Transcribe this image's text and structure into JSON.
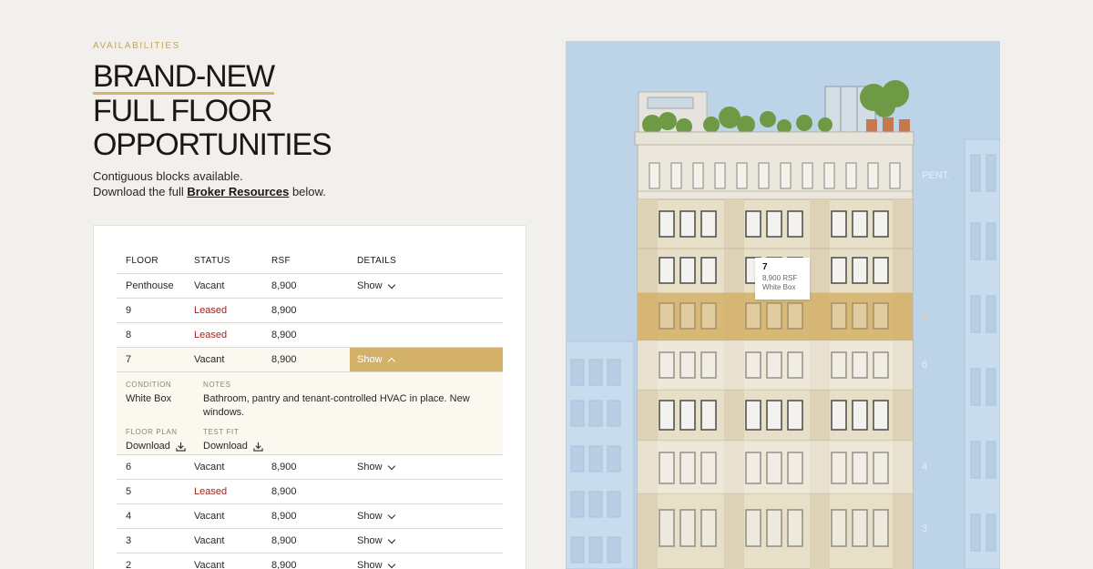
{
  "eyebrow": "AVAILABILITIES",
  "headline": {
    "line1": "BRAND-NEW",
    "line2": "FULL FLOOR",
    "line3": "OPPORTUNITIES"
  },
  "intro": {
    "line1": "Contiguous blocks available.",
    "line2_prefix": "Download the full ",
    "link": "Broker Resources",
    "line2_suffix": " below."
  },
  "table": {
    "headers": {
      "floor": "FLOOR",
      "status": "STATUS",
      "rsf": "RSF",
      "details": "DETAILS"
    },
    "rows": [
      {
        "floor": "Penthouse",
        "status": "Vacant",
        "rsf": "8,900",
        "details": "Show"
      },
      {
        "floor": "9",
        "status": "Leased",
        "rsf": "8,900",
        "details": ""
      },
      {
        "floor": "8",
        "status": "Leased",
        "rsf": "8,900",
        "details": ""
      },
      {
        "floor": "7",
        "status": "Vacant",
        "rsf": "8,900",
        "details": "Show"
      },
      {
        "floor": "6",
        "status": "Vacant",
        "rsf": "8,900",
        "details": "Show"
      },
      {
        "floor": "5",
        "status": "Leased",
        "rsf": "8,900",
        "details": ""
      },
      {
        "floor": "4",
        "status": "Vacant",
        "rsf": "8,900",
        "details": "Show"
      },
      {
        "floor": "3",
        "status": "Vacant",
        "rsf": "8,900",
        "details": "Show"
      },
      {
        "floor": "2",
        "status": "Vacant",
        "rsf": "8,900",
        "details": "Show"
      }
    ],
    "expanded": {
      "condition_label": "CONDITION",
      "condition": "White Box",
      "notes_label": "NOTES",
      "notes": "Bathroom, pantry and tenant-controlled HVAC in place. New windows.",
      "floor_plan_label": "FLOOR PLAN",
      "floor_plan_link": "Download",
      "test_fit_label": "TEST FIT",
      "test_fit_link": "Download"
    }
  },
  "building": {
    "tooltip": {
      "floor": "7",
      "rsf": "8,900 RSF",
      "condition": "White Box"
    },
    "floor_labels": {
      "pent": "PENT.",
      "f7": "7",
      "f6": "6",
      "f4": "4",
      "f3": "3"
    }
  },
  "colors": {
    "accent": "#d3b169",
    "leased": "#a3221e",
    "sky": "#bcd3e8"
  }
}
